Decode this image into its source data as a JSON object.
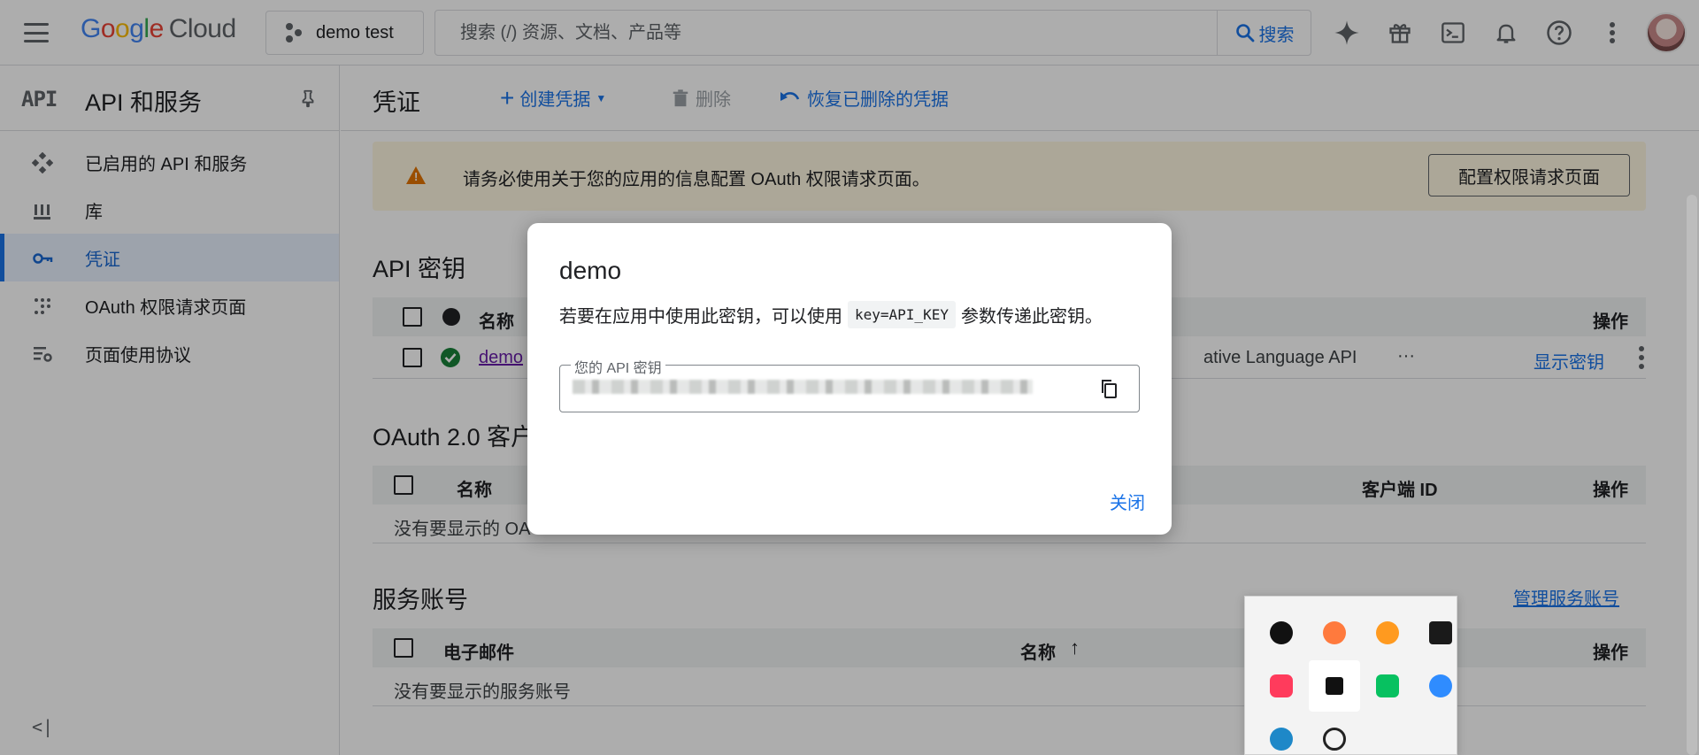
{
  "topbar": {
    "logo_google": [
      "G",
      "o",
      "o",
      "g",
      "l",
      "e"
    ],
    "logo_cloud": "Cloud",
    "project": "demo test",
    "search_placeholder": "搜索 (/) 资源、文档、产品等",
    "search_button": "搜索"
  },
  "sidebar": {
    "logo": "API",
    "title": "API 和服务",
    "items": [
      {
        "label": "已启用的 API 和服务",
        "icon": "diamond-grid-icon"
      },
      {
        "label": "库",
        "icon": "library-icon"
      },
      {
        "label": "凭证",
        "icon": "key-icon"
      },
      {
        "label": "OAuth 权限请求页面",
        "icon": "dots-grid-icon"
      },
      {
        "label": "页面使用协议",
        "icon": "settings-list-icon"
      }
    ],
    "collapse": "<|"
  },
  "main": {
    "title": "凭证",
    "create": "创建凭据",
    "delete": "删除",
    "restore": "恢复已删除的凭据",
    "banner_text": "请务必使用关于您的应用的信息配置 OAuth 权限请求页面。",
    "banner_button": "配置权限请求页面",
    "api_keys": {
      "title": "API 密钥",
      "col_name": "名称",
      "col_actions": "操作",
      "row_name": "demo",
      "row_restriction": "ative Language API",
      "row_more": "···",
      "row_show_key": "显示密钥"
    },
    "oauth": {
      "title": "OAuth 2.0 客户",
      "col_name": "名称",
      "col_client_id": "客户端 ID",
      "col_actions": "操作",
      "empty": "没有要显示的 OA"
    },
    "service": {
      "title": "服务账号",
      "manage": "管理服务账号",
      "col_email": "电子邮件",
      "col_name": "名称",
      "col_actions": "操作",
      "empty": "没有要显示的服务账号"
    }
  },
  "dialog": {
    "title": "demo",
    "text_before": "若要在应用中使用此密钥，可以使用",
    "code": "key=API_KEY",
    "text_after": "参数传递此密钥。",
    "field_label": "您的 API 密钥",
    "close": "关闭"
  },
  "tray": {
    "icons": [
      {
        "name": "qq-icon",
        "color": "#111111"
      },
      {
        "name": "cat-app-icon",
        "color": "#ff7a3d"
      },
      {
        "name": "flame-app-icon",
        "color": "#ff9a1f"
      },
      {
        "name": "jetbrains-toolbox-icon",
        "color": "#1a1a1a"
      },
      {
        "name": "red-app-icon",
        "color": "#ff3b5c"
      },
      {
        "name": "black-square-app-icon",
        "color": "#111111"
      },
      {
        "name": "wechat-icon",
        "color": "#07c160"
      },
      {
        "name": "blue-search-app-icon",
        "color": "#2f8cff"
      },
      {
        "name": "security-shield-icon",
        "color": "#1e88c8"
      },
      {
        "name": "openai-icon",
        "color": "#222222"
      }
    ]
  }
}
